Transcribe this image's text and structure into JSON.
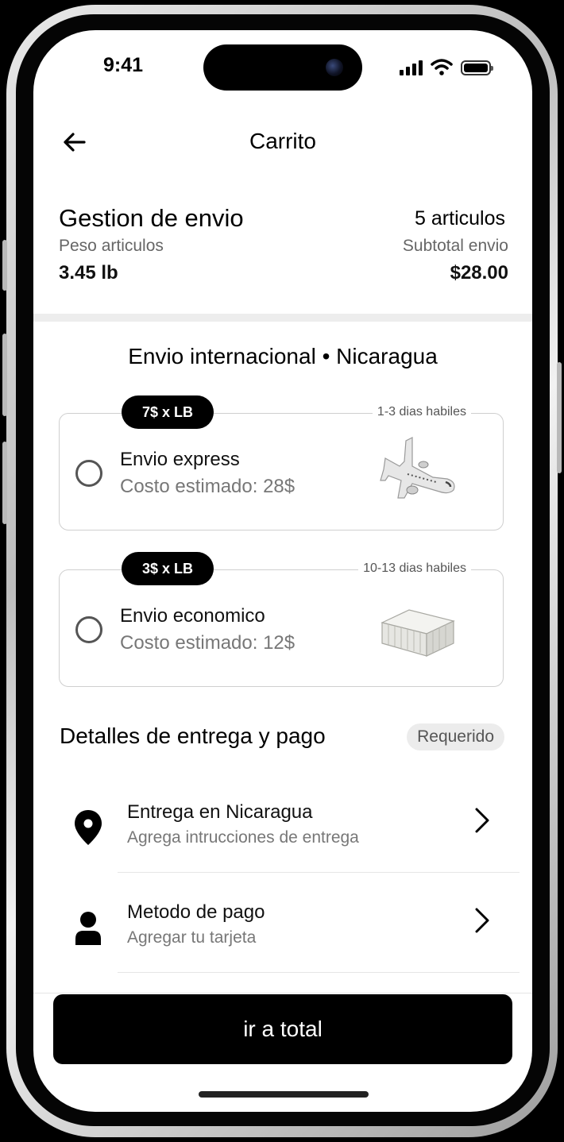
{
  "status_bar": {
    "time": "9:41"
  },
  "header": {
    "title": "Carrito"
  },
  "summary": {
    "title": "Gestion de envio",
    "item_count": "5 articulos",
    "weight_label": "Peso articulos",
    "weight_value": "3.45 lb",
    "subtotal_label": "Subtotal envio",
    "subtotal_value": "$28.00"
  },
  "shipping": {
    "title": "Envio internacional • Nicaragua",
    "options": [
      {
        "rate": "7$ x LB",
        "days": "1-3 dias habiles",
        "name": "Envio express",
        "cost": "Costo estimado: 28$",
        "icon": "airplane-icon",
        "selected": false
      },
      {
        "rate": "3$ x LB",
        "days": "10-13 dias habiles",
        "name": "Envio economico",
        "cost": "Costo estimado: 12$",
        "icon": "shipping-container-icon",
        "selected": false
      }
    ]
  },
  "details": {
    "title": "Detalles de entrega y pago",
    "badge": "Requerido",
    "rows": [
      {
        "title": "Entrega en Nicaragua",
        "subtitle": "Agrega intrucciones de entrega",
        "icon": "location-pin-icon"
      },
      {
        "title": "Metodo de pago",
        "subtitle": "Agregar tu tarjeta",
        "icon": "user-icon"
      }
    ]
  },
  "cta": {
    "label": "ir a total"
  },
  "colors": {
    "accent": "#000000",
    "background": "#ffffff",
    "muted_text": "#777777",
    "badge_bg": "#ececec"
  }
}
